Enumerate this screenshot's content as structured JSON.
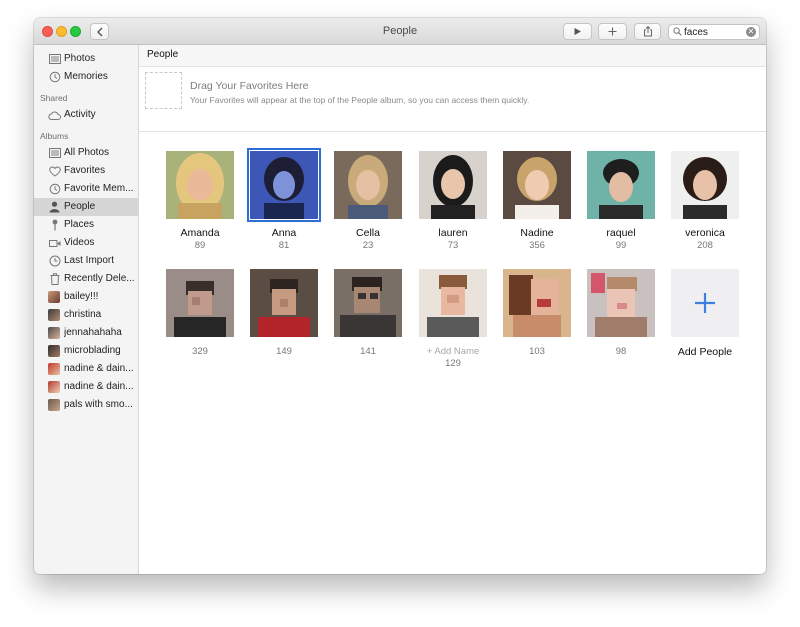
{
  "window": {
    "title": "People"
  },
  "toolbar": {
    "back_icon": "chevron-left-icon",
    "play_icon": "play-icon",
    "add_icon": "plus-icon",
    "share_icon": "share-icon",
    "search_value": "faces"
  },
  "sidebar": {
    "library": [
      {
        "label": "Photos",
        "icon": "photos-icon"
      },
      {
        "label": "Memories",
        "icon": "memories-icon"
      }
    ],
    "shared_heading": "Shared",
    "shared": [
      {
        "label": "Activity",
        "icon": "cloud-icon"
      }
    ],
    "albums_heading": "Albums",
    "albums": [
      {
        "label": "All Photos",
        "icon": "album-icon"
      },
      {
        "label": "Favorites",
        "icon": "heart-icon"
      },
      {
        "label": "Favorite Mem...",
        "icon": "memories-icon"
      },
      {
        "label": "People",
        "icon": "person-icon",
        "active": true
      },
      {
        "label": "Places",
        "icon": "pin-icon"
      },
      {
        "label": "Videos",
        "icon": "video-icon"
      },
      {
        "label": "Last Import",
        "icon": "clock-icon"
      },
      {
        "label": "Recently Dele...",
        "icon": "trash-icon"
      },
      {
        "label": "bailey!!!",
        "icon": "album-thumb"
      },
      {
        "label": "christina",
        "icon": "album-thumb"
      },
      {
        "label": "jennahahaha",
        "icon": "album-thumb"
      },
      {
        "label": "microblading",
        "icon": "album-thumb"
      },
      {
        "label": "nadine & dain...",
        "icon": "album-thumb"
      },
      {
        "label": "nadine & dain...",
        "icon": "album-thumb"
      },
      {
        "label": "pals with smo...",
        "icon": "album-thumb"
      }
    ]
  },
  "main": {
    "header_title": "People",
    "favorites_title": "Drag Your Favorites Here",
    "favorites_subtitle": "Your Favorites will appear at the top of the People album, so you can access them quickly.",
    "people_row1": [
      {
        "name": "Amanda",
        "count": "89"
      },
      {
        "name": "Anna",
        "count": "81",
        "selected": true
      },
      {
        "name": "Cella",
        "count": "23"
      },
      {
        "name": "lauren",
        "count": "73"
      },
      {
        "name": "Nadine",
        "count": "356"
      },
      {
        "name": "raquel",
        "count": "99"
      },
      {
        "name": "veronica",
        "count": "208"
      }
    ],
    "people_row2": [
      {
        "count": "329"
      },
      {
        "count": "149"
      },
      {
        "count": "141"
      },
      {
        "add_name": "+ Add Name",
        "count": "129"
      },
      {
        "count": "103"
      },
      {
        "count": "98"
      }
    ],
    "add_people_label": "Add People"
  },
  "colors": {
    "accent": "#2b6fd6",
    "selection_sidebar": "#d6d6d6"
  }
}
